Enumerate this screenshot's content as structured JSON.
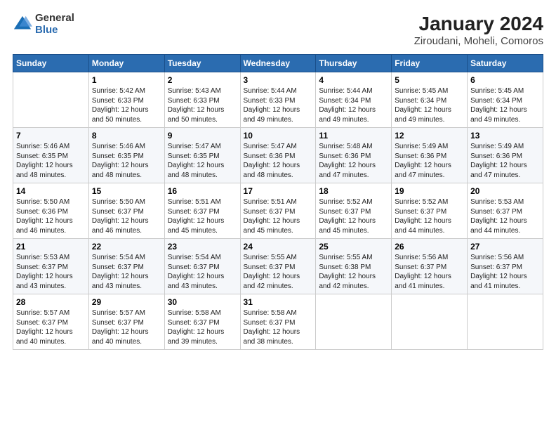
{
  "header": {
    "logo": {
      "general": "General",
      "blue": "Blue"
    },
    "title": "January 2024",
    "subtitle": "Ziroudani, Moheli, Comoros"
  },
  "days_of_week": [
    "Sunday",
    "Monday",
    "Tuesday",
    "Wednesday",
    "Thursday",
    "Friday",
    "Saturday"
  ],
  "weeks": [
    [
      {
        "day": "",
        "info": ""
      },
      {
        "day": "1",
        "info": "Sunrise: 5:42 AM\nSunset: 6:33 PM\nDaylight: 12 hours\nand 50 minutes."
      },
      {
        "day": "2",
        "info": "Sunrise: 5:43 AM\nSunset: 6:33 PM\nDaylight: 12 hours\nand 50 minutes."
      },
      {
        "day": "3",
        "info": "Sunrise: 5:44 AM\nSunset: 6:33 PM\nDaylight: 12 hours\nand 49 minutes."
      },
      {
        "day": "4",
        "info": "Sunrise: 5:44 AM\nSunset: 6:34 PM\nDaylight: 12 hours\nand 49 minutes."
      },
      {
        "day": "5",
        "info": "Sunrise: 5:45 AM\nSunset: 6:34 PM\nDaylight: 12 hours\nand 49 minutes."
      },
      {
        "day": "6",
        "info": "Sunrise: 5:45 AM\nSunset: 6:34 PM\nDaylight: 12 hours\nand 49 minutes."
      }
    ],
    [
      {
        "day": "7",
        "info": "Sunrise: 5:46 AM\nSunset: 6:35 PM\nDaylight: 12 hours\nand 48 minutes."
      },
      {
        "day": "8",
        "info": "Sunrise: 5:46 AM\nSunset: 6:35 PM\nDaylight: 12 hours\nand 48 minutes."
      },
      {
        "day": "9",
        "info": "Sunrise: 5:47 AM\nSunset: 6:35 PM\nDaylight: 12 hours\nand 48 minutes."
      },
      {
        "day": "10",
        "info": "Sunrise: 5:47 AM\nSunset: 6:36 PM\nDaylight: 12 hours\nand 48 minutes."
      },
      {
        "day": "11",
        "info": "Sunrise: 5:48 AM\nSunset: 6:36 PM\nDaylight: 12 hours\nand 47 minutes."
      },
      {
        "day": "12",
        "info": "Sunrise: 5:49 AM\nSunset: 6:36 PM\nDaylight: 12 hours\nand 47 minutes."
      },
      {
        "day": "13",
        "info": "Sunrise: 5:49 AM\nSunset: 6:36 PM\nDaylight: 12 hours\nand 47 minutes."
      }
    ],
    [
      {
        "day": "14",
        "info": "Sunrise: 5:50 AM\nSunset: 6:36 PM\nDaylight: 12 hours\nand 46 minutes."
      },
      {
        "day": "15",
        "info": "Sunrise: 5:50 AM\nSunset: 6:37 PM\nDaylight: 12 hours\nand 46 minutes."
      },
      {
        "day": "16",
        "info": "Sunrise: 5:51 AM\nSunset: 6:37 PM\nDaylight: 12 hours\nand 45 minutes."
      },
      {
        "day": "17",
        "info": "Sunrise: 5:51 AM\nSunset: 6:37 PM\nDaylight: 12 hours\nand 45 minutes."
      },
      {
        "day": "18",
        "info": "Sunrise: 5:52 AM\nSunset: 6:37 PM\nDaylight: 12 hours\nand 45 minutes."
      },
      {
        "day": "19",
        "info": "Sunrise: 5:52 AM\nSunset: 6:37 PM\nDaylight: 12 hours\nand 44 minutes."
      },
      {
        "day": "20",
        "info": "Sunrise: 5:53 AM\nSunset: 6:37 PM\nDaylight: 12 hours\nand 44 minutes."
      }
    ],
    [
      {
        "day": "21",
        "info": "Sunrise: 5:53 AM\nSunset: 6:37 PM\nDaylight: 12 hours\nand 43 minutes."
      },
      {
        "day": "22",
        "info": "Sunrise: 5:54 AM\nSunset: 6:37 PM\nDaylight: 12 hours\nand 43 minutes."
      },
      {
        "day": "23",
        "info": "Sunrise: 5:54 AM\nSunset: 6:37 PM\nDaylight: 12 hours\nand 43 minutes."
      },
      {
        "day": "24",
        "info": "Sunrise: 5:55 AM\nSunset: 6:37 PM\nDaylight: 12 hours\nand 42 minutes."
      },
      {
        "day": "25",
        "info": "Sunrise: 5:55 AM\nSunset: 6:38 PM\nDaylight: 12 hours\nand 42 minutes."
      },
      {
        "day": "26",
        "info": "Sunrise: 5:56 AM\nSunset: 6:37 PM\nDaylight: 12 hours\nand 41 minutes."
      },
      {
        "day": "27",
        "info": "Sunrise: 5:56 AM\nSunset: 6:37 PM\nDaylight: 12 hours\nand 41 minutes."
      }
    ],
    [
      {
        "day": "28",
        "info": "Sunrise: 5:57 AM\nSunset: 6:37 PM\nDaylight: 12 hours\nand 40 minutes."
      },
      {
        "day": "29",
        "info": "Sunrise: 5:57 AM\nSunset: 6:37 PM\nDaylight: 12 hours\nand 40 minutes."
      },
      {
        "day": "30",
        "info": "Sunrise: 5:58 AM\nSunset: 6:37 PM\nDaylight: 12 hours\nand 39 minutes."
      },
      {
        "day": "31",
        "info": "Sunrise: 5:58 AM\nSunset: 6:37 PM\nDaylight: 12 hours\nand 38 minutes."
      },
      {
        "day": "",
        "info": ""
      },
      {
        "day": "",
        "info": ""
      },
      {
        "day": "",
        "info": ""
      }
    ]
  ]
}
